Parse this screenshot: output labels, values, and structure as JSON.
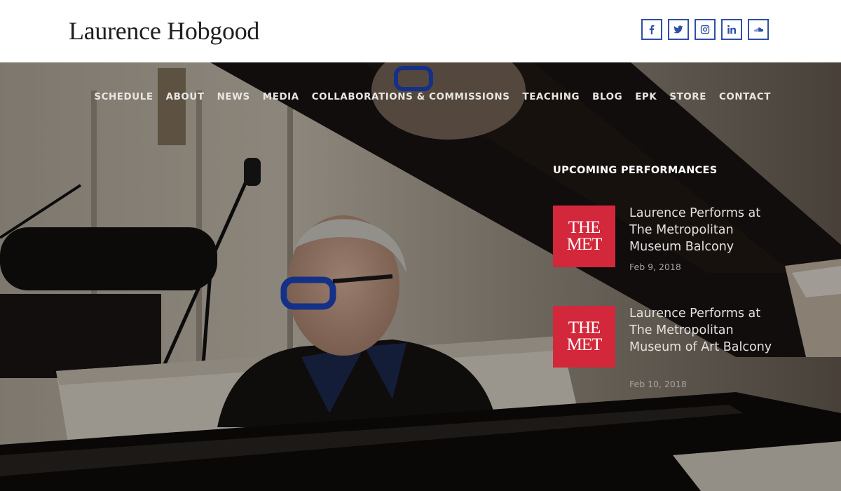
{
  "site": {
    "title": "Laurence Hobgood"
  },
  "social": [
    {
      "icon": "facebook-icon",
      "label": "f"
    },
    {
      "icon": "twitter-icon",
      "label": "t"
    },
    {
      "icon": "instagram-icon",
      "label": "ig"
    },
    {
      "icon": "linkedin-icon",
      "label": "in"
    },
    {
      "icon": "soundcloud-icon",
      "label": "sc"
    }
  ],
  "nav": {
    "items": [
      "SCHEDULE",
      "ABOUT",
      "NEWS",
      "MEDIA",
      "COLLABORATIONS & COMMISSIONS",
      "TEACHING",
      "BLOG",
      "EPK",
      "STORE",
      "CONTACT"
    ]
  },
  "upcoming": {
    "heading": "UPCOMING PERFORMANCES",
    "events": [
      {
        "thumb_line1": "THE",
        "thumb_line2": "MET",
        "title": "Laurence Performs at The Metropolitan Museum Balcony",
        "date": "Feb 9, 2018"
      },
      {
        "thumb_line1": "THE",
        "thumb_line2": "MET",
        "title": "Laurence Performs at The Metropolitan Museum of Art Balcony",
        "date": "Feb 10, 2018"
      }
    ]
  },
  "colors": {
    "social_border": "#2f4fa8",
    "met_red": "#d3283b"
  }
}
